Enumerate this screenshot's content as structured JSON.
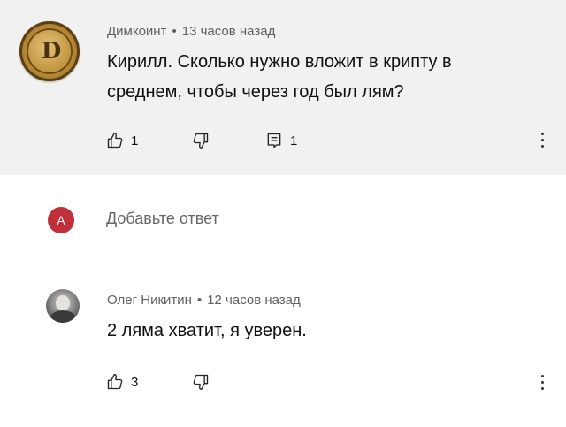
{
  "comment_1": {
    "author": "Димкоинт",
    "separator": "•",
    "time": "13 часов назад",
    "text_line1": "Кирилл. Сколько нужно вложит в крипту в",
    "text_line2": "среднем, чтобы через год был лям?",
    "avatar_letter": "D",
    "likes": "1",
    "replies": "1"
  },
  "reply_box": {
    "avatar_letter": "A",
    "placeholder": "Добавьте ответ",
    "avatar_color": "#c02f3a"
  },
  "comment_2": {
    "author": "Олег Никитин",
    "separator": "•",
    "time": "12 часов назад",
    "text": "2 ляма хватит, я уверен.",
    "likes": "3"
  },
  "icons": {
    "like": "thumbs-up-icon",
    "dislike": "thumbs-down-icon",
    "reply": "reply-icon",
    "more": "more-vertical-icon"
  },
  "colors": {
    "comment_bg": "#f1f1f1",
    "meta_text": "#606060",
    "placeholder_text": "#666666"
  }
}
